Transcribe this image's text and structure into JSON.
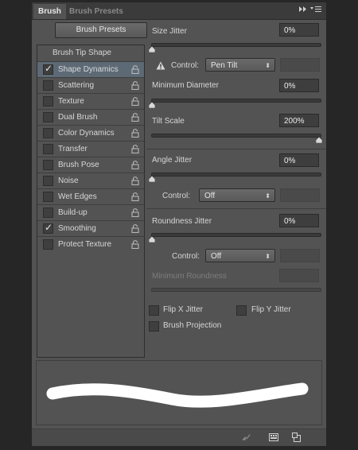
{
  "tabs": [
    {
      "label": "Brush",
      "active": true
    },
    {
      "label": "Brush Presets",
      "active": false
    }
  ],
  "tab_icons": {
    "expand": "double-arrow-icon",
    "menu": "panel-menu-icon"
  },
  "brush_presets_button": "Brush Presets",
  "sidebar": {
    "header": "Brush Tip Shape",
    "items": [
      {
        "label": "Shape Dynamics",
        "checked": true,
        "selected": true
      },
      {
        "label": "Scattering",
        "checked": false
      },
      {
        "label": "Texture",
        "checked": false
      },
      {
        "label": "Dual Brush",
        "checked": false
      },
      {
        "label": "Color Dynamics",
        "checked": false
      },
      {
        "label": "Transfer",
        "checked": false
      },
      {
        "label": "Brush Pose",
        "checked": false
      },
      {
        "label": "Noise",
        "checked": false
      },
      {
        "label": "Wet Edges",
        "checked": false
      },
      {
        "label": "Build-up",
        "checked": false
      },
      {
        "label": "Smoothing",
        "checked": true
      },
      {
        "label": "Protect Texture",
        "checked": false
      }
    ],
    "check_mark": "✓"
  },
  "controls": {
    "size_jitter": {
      "label": "Size Jitter",
      "value": "0%"
    },
    "size_control": {
      "label": "Control:",
      "value": "Pen Tilt"
    },
    "minimum_diameter": {
      "label": "Minimum Diameter",
      "value": "0%"
    },
    "tilt_scale": {
      "label": "Tilt Scale",
      "value": "200%"
    },
    "angle_jitter": {
      "label": "Angle Jitter",
      "value": "0%"
    },
    "angle_control": {
      "label": "Control:",
      "value": "Off"
    },
    "roundness_jitter": {
      "label": "Roundness Jitter",
      "value": "0%"
    },
    "roundness_control": {
      "label": "Control:",
      "value": "Off"
    },
    "minimum_roundness": {
      "label": "Minimum Roundness",
      "value": ""
    },
    "flip_x": {
      "label": "Flip X Jitter",
      "checked": false
    },
    "flip_y": {
      "label": "Flip Y Jitter",
      "checked": false
    },
    "brush_projection": {
      "label": "Brush Projection",
      "checked": false
    }
  },
  "select_arrow": "⬍",
  "colors": {
    "panel": "#535353",
    "selected_row": "#5d6a76",
    "stroke": "#ffffff",
    "warning": "#d8d8d8"
  }
}
